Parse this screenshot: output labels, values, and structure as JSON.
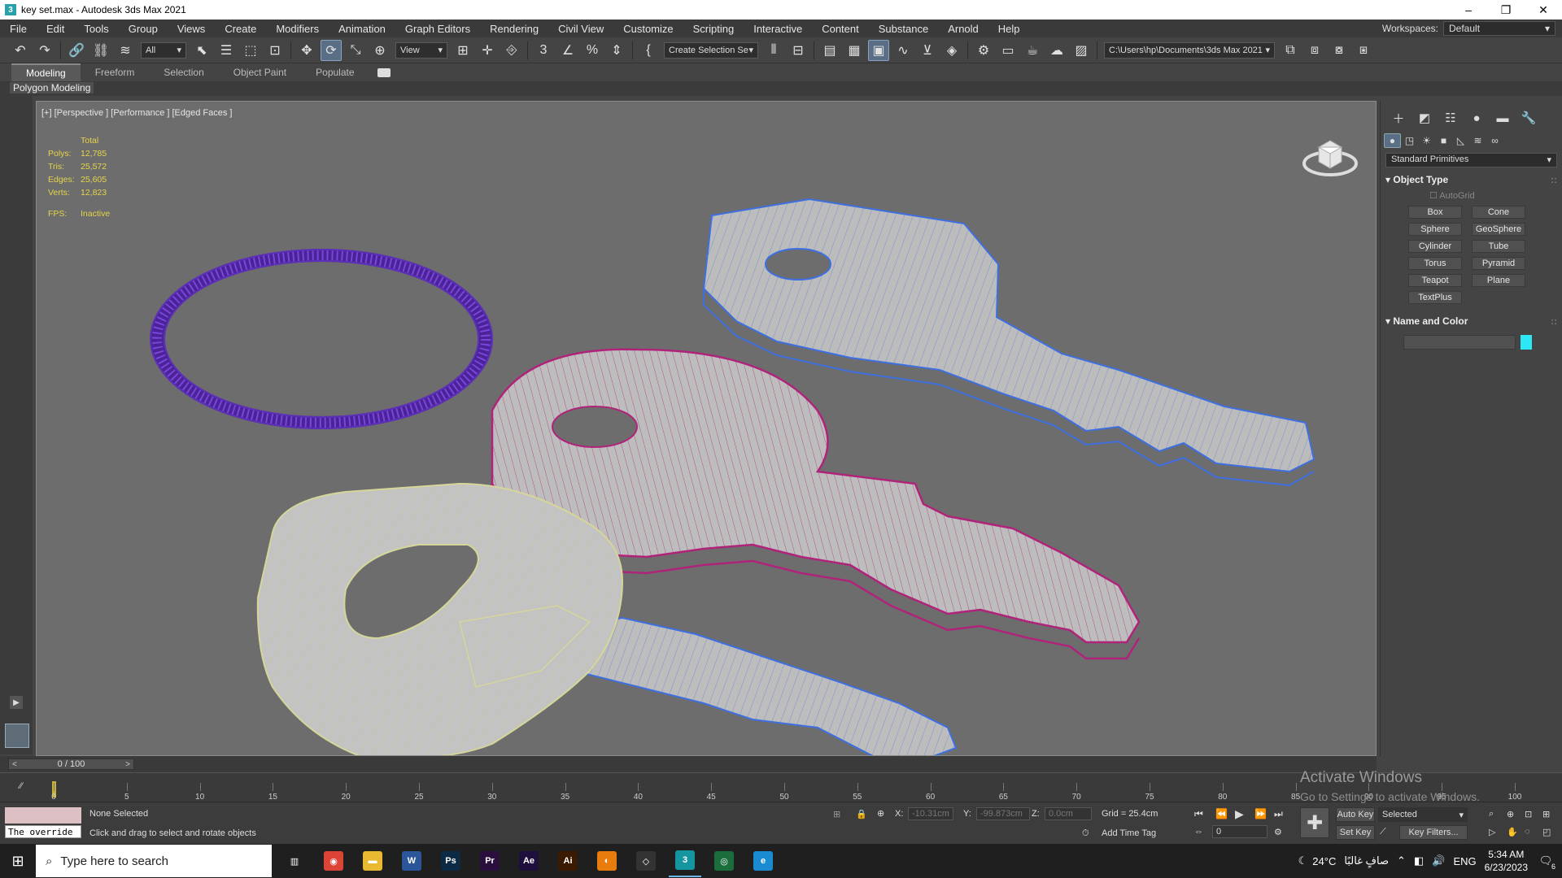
{
  "window": {
    "title": "key set.max - Autodesk 3ds Max 2021",
    "min": "–",
    "max": "❐",
    "close": "✕"
  },
  "menu": [
    "File",
    "Edit",
    "Tools",
    "Group",
    "Views",
    "Create",
    "Modifiers",
    "Animation",
    "Graph Editors",
    "Rendering",
    "Civil View",
    "Customize",
    "Scripting",
    "Interactive",
    "Content",
    "Substance",
    "Arnold",
    "Help"
  ],
  "workspace": {
    "label": "Workspaces:",
    "value": "Default"
  },
  "toolbar": {
    "filter": "All",
    "view": "View",
    "selection_set": "Create Selection Se",
    "path": "C:\\Users\\hp\\Documents\\3ds Max 2021"
  },
  "ribbon": {
    "tabs": [
      "Modeling",
      "Freeform",
      "Selection",
      "Object Paint",
      "Populate"
    ],
    "active": "Modeling",
    "sub": "Polygon Modeling"
  },
  "viewport": {
    "label": "[+] [Perspective ] [Performance ] [Edged Faces ]",
    "stats": {
      "header": "Total",
      "rows": [
        {
          "k": "Polys:",
          "v": "12,785"
        },
        {
          "k": "Tris:",
          "v": "25,572"
        },
        {
          "k": "Edges:",
          "v": "25,605"
        },
        {
          "k": "Verts:",
          "v": "12,823"
        }
      ],
      "fps_k": "FPS:",
      "fps_v": "Inactive"
    }
  },
  "command_panel": {
    "dropdown": "Standard Primitives",
    "object_type": "Object Type",
    "autogrid": "AutoGrid",
    "primitives": [
      "Box",
      "Cone",
      "Sphere",
      "GeoSphere",
      "Cylinder",
      "Tube",
      "Torus",
      "Pyramid",
      "Teapot",
      "Plane",
      "TextPlus"
    ],
    "name_and_color": "Name and Color",
    "color": "#2de8f4"
  },
  "timeline": {
    "frame": "0 / 100",
    "marks": [
      "0",
      "5",
      "10",
      "15",
      "20",
      "25",
      "30",
      "35",
      "40",
      "45",
      "50",
      "55",
      "60",
      "65",
      "70",
      "75",
      "80",
      "85",
      "90",
      "95",
      "100"
    ]
  },
  "status": {
    "selected": "None Selected",
    "prompt": "Click and drag to select and rotate objects",
    "override": "The override",
    "x_label": "X:",
    "x": "-10.31cm",
    "y_label": "Y:",
    "y": "-99.873cm",
    "z_label": "Z:",
    "z": "0.0cm",
    "grid": "Grid = 25.4cm",
    "add_time_tag": "Add Time Tag",
    "auto_key": "Auto Key",
    "set_key": "Set Key",
    "selected_dd": "Selected",
    "key_filters": "Key Filters...",
    "frame_field": "0"
  },
  "watermark": {
    "line1": "Activate Windows",
    "line2": "Go to Settings to activate Windows."
  },
  "taskbar": {
    "search": "Type here to search",
    "apps": [
      {
        "name": "task-view",
        "label": "▥",
        "color": "#1f1f1f"
      },
      {
        "name": "chrome",
        "label": "◉",
        "color": "#db4437"
      },
      {
        "name": "file-explorer",
        "label": "▬",
        "color": "#e8b931"
      },
      {
        "name": "word",
        "label": "W",
        "color": "#2b579a"
      },
      {
        "name": "photoshop",
        "label": "Ps",
        "color": "#0d2a44"
      },
      {
        "name": "premiere",
        "label": "Pr",
        "color": "#2a0f3d"
      },
      {
        "name": "after-effects",
        "label": "Ae",
        "color": "#1f0f3d"
      },
      {
        "name": "illustrator",
        "label": "Ai",
        "color": "#3a1a00"
      },
      {
        "name": "blender",
        "label": "◐",
        "color": "#e87d0d"
      },
      {
        "name": "unity",
        "label": "◇",
        "color": "#333"
      },
      {
        "name": "3ds-max",
        "label": "3",
        "color": "#14959f"
      },
      {
        "name": "app-circle",
        "label": "◎",
        "color": "#1b6e3c"
      },
      {
        "name": "edge",
        "label": "e",
        "color": "#1b8bd1"
      }
    ],
    "weather": "24°C",
    "weather_text": "صافٍ غالبًا",
    "lang": "ENG",
    "time": "5:34 AM",
    "date": "6/23/2023",
    "notif": "6"
  }
}
